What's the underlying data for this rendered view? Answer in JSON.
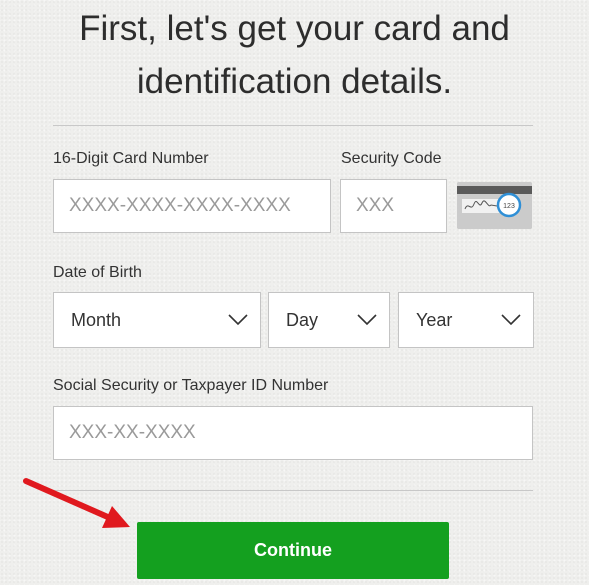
{
  "heading": {
    "line1": "First, let's get your card and",
    "line2": "identification details."
  },
  "card_number": {
    "label": "16-Digit Card Number",
    "placeholder": "XXXX-XXXX-XXXX-XXXX",
    "value": ""
  },
  "security_code": {
    "label": "Security Code",
    "placeholder": "XXX",
    "value": "",
    "card_hint_text": "123"
  },
  "date_of_birth": {
    "label": "Date of Birth",
    "month": "Month",
    "day": "Day",
    "year": "Year"
  },
  "ssn": {
    "label": "Social Security or Taxpayer ID Number",
    "placeholder": "XXX-XX-XXXX",
    "value": ""
  },
  "continue_button": {
    "label": "Continue"
  },
  "colors": {
    "primary_button": "#14a01f",
    "annotation_arrow": "#e0191e",
    "security_hint_circle": "#2f8fd6"
  }
}
